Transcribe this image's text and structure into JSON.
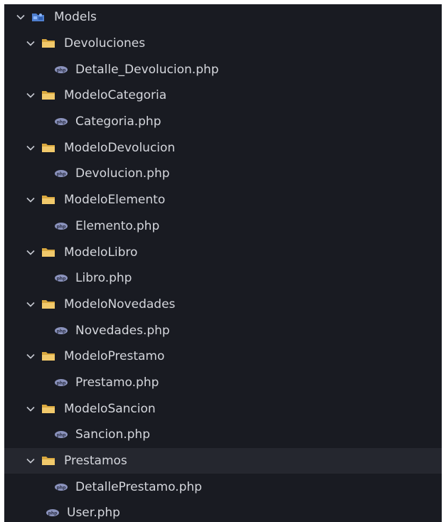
{
  "explorer": {
    "root": {
      "label": "Models",
      "expanded": true,
      "icon": "models-folder-icon"
    },
    "items": [
      {
        "label": "Devoluciones",
        "type": "folder",
        "level": 1,
        "expanded": true
      },
      {
        "label": "Detalle_Devolucion.php",
        "type": "file",
        "level": 2
      },
      {
        "label": "ModeloCategoria",
        "type": "folder",
        "level": 1,
        "expanded": true
      },
      {
        "label": "Categoria.php",
        "type": "file",
        "level": 2
      },
      {
        "label": "ModeloDevolucion",
        "type": "folder",
        "level": 1,
        "expanded": true
      },
      {
        "label": "Devolucion.php",
        "type": "file",
        "level": 2
      },
      {
        "label": "ModeloElemento",
        "type": "folder",
        "level": 1,
        "expanded": true
      },
      {
        "label": "Elemento.php",
        "type": "file",
        "level": 2
      },
      {
        "label": "ModeloLibro",
        "type": "folder",
        "level": 1,
        "expanded": true
      },
      {
        "label": "Libro.php",
        "type": "file",
        "level": 2
      },
      {
        "label": "ModeloNovedades",
        "type": "folder",
        "level": 1,
        "expanded": true
      },
      {
        "label": "Novedades.php",
        "type": "file",
        "level": 2
      },
      {
        "label": "ModeloPrestamo",
        "type": "folder",
        "level": 1,
        "expanded": true
      },
      {
        "label": "Prestamo.php",
        "type": "file",
        "level": 2
      },
      {
        "label": "ModeloSancion",
        "type": "folder",
        "level": 1,
        "expanded": true
      },
      {
        "label": "Sancion.php",
        "type": "file",
        "level": 2
      },
      {
        "label": "Prestamos",
        "type": "folder",
        "level": 1,
        "expanded": true,
        "selected": true
      },
      {
        "label": "DetallePrestamo.php",
        "type": "file",
        "level": 2
      },
      {
        "label": "User.php",
        "type": "file",
        "level": 1
      }
    ]
  },
  "colors": {
    "background": "#191b22",
    "selected_row": "#25272f",
    "text": "#d4d6dc",
    "folder": "#e8c16a",
    "php_icon": "#9aa3c7",
    "models_icon": "#6b9de8"
  }
}
